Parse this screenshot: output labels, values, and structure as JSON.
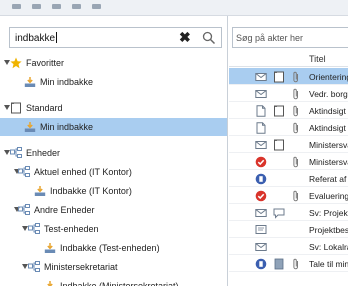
{
  "left_panel": {
    "search": {
      "value": "indbakke"
    },
    "tree": [
      {
        "label": "Favoritter",
        "icon": "star-icon",
        "indent": 0,
        "arrow": true,
        "selected": false
      },
      {
        "label": "Min indbakke",
        "icon": "inbox-icon",
        "indent": 1,
        "arrow": false,
        "selected": false
      },
      {
        "label": "Standard",
        "icon": "folder-icon",
        "indent": 0,
        "arrow": true,
        "selected": false
      },
      {
        "label": "Min indbakke",
        "icon": "inbox-icon",
        "indent": 1,
        "arrow": false,
        "selected": true
      },
      {
        "label": "Enheder",
        "icon": "org-unit-icon",
        "indent": 0,
        "arrow": true,
        "selected": false
      },
      {
        "label": "Aktuel enhed (IT Kontor)",
        "icon": "org-unit-icon",
        "indent": 1,
        "arrow": true,
        "selected": false
      },
      {
        "label": "Indbakke (IT Kontor)",
        "icon": "inbox-icon",
        "indent": 2,
        "arrow": false,
        "selected": false
      },
      {
        "label": "Andre Enheder",
        "icon": "org-unit-icon",
        "indent": 1,
        "arrow": true,
        "selected": false
      },
      {
        "label": "Test-enheden",
        "icon": "org-unit-icon",
        "indent": 2,
        "arrow": true,
        "selected": false
      },
      {
        "label": "Indbakke (Test-enheden)",
        "icon": "inbox-icon",
        "indent": 3,
        "arrow": false,
        "selected": false
      },
      {
        "label": "Ministersekretariat",
        "icon": "org-unit-icon",
        "indent": 2,
        "arrow": true,
        "selected": false
      },
      {
        "label": "Indbakke (Ministersekretariat)",
        "icon": "inbox-icon",
        "indent": 3,
        "arrow": false,
        "selected": false
      }
    ]
  },
  "right_panel": {
    "search_placeholder": "Søg på akter her",
    "column_title": "Titel",
    "rows": [
      {
        "title": "Orientering",
        "icons": [
          "mail-icon",
          "folder-icon",
          "attachment-icon"
        ],
        "selected": true
      },
      {
        "title": "Vedr. borger",
        "icons": [
          "mail-icon",
          "",
          "attachment-icon"
        ],
        "selected": false
      },
      {
        "title": "Aktindsigt",
        "icons": [
          "document-icon",
          "folder-icon",
          "attachment-icon"
        ],
        "selected": false
      },
      {
        "title": "Aktindsigt",
        "icons": [
          "document-icon",
          "",
          "attachment-icon"
        ],
        "selected": false
      },
      {
        "title": "Ministersvar",
        "icons": [
          "mail-icon",
          "folder-icon",
          ""
        ],
        "selected": false
      },
      {
        "title": "Ministersvar",
        "icons": [
          "alert-icon",
          "",
          "attachment-icon"
        ],
        "selected": false
      },
      {
        "title": "Referat af møde",
        "icons": [
          "blocked-icon",
          "",
          ""
        ],
        "selected": false
      },
      {
        "title": "Evaluering",
        "icons": [
          "alert-icon",
          "",
          "attachment-icon"
        ],
        "selected": false
      },
      {
        "title": "Sv: Projekt",
        "icons": [
          "mail-icon",
          "comment-icon",
          ""
        ],
        "selected": false
      },
      {
        "title": "Projektbeskrivelse",
        "icons": [
          "note-icon",
          "",
          ""
        ],
        "selected": false
      },
      {
        "title": "Sv: Lokalrådet",
        "icons": [
          "mail-icon",
          "",
          ""
        ],
        "selected": false
      },
      {
        "title": "Tale til minister",
        "icons": [
          "blocked-icon",
          "book-icon",
          "attachment-icon"
        ],
        "selected": false
      }
    ]
  },
  "colors": {
    "selection": "#a9cdf0",
    "star": "#f0b400",
    "inbox": "#e8a530",
    "org": "#6a8bb5",
    "alert": "#d9342b",
    "blocked": "#3b5fb0"
  }
}
